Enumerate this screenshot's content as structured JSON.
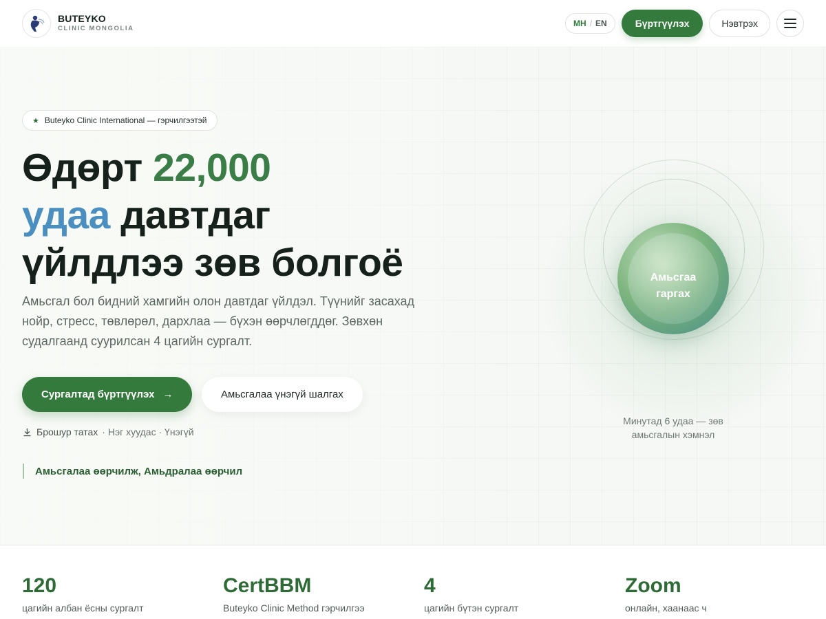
{
  "header": {
    "brand_name": "BUTEYKO",
    "brand_sub": "CLINIC MONGOLIA",
    "lang_active": "МН",
    "lang_separator": "/",
    "lang_other": "EN",
    "register_label": "Бүртгүүлэх",
    "login_label": "Нэвтрэх"
  },
  "hero": {
    "badge": "Buteyko Clinic International — гэрчилгээтэй",
    "headline_part1": "Өдөрт ",
    "headline_highlight1": "22,000",
    "headline_highlight2": "удаа",
    "headline_part2": " давтдаг",
    "headline_part3": "үйлдлээ зөв болгоё",
    "lead": "Амьсгал бол бидний хамгийн олон давтдаг үйлдэл. Түүнийг засахад нойр, стресс, төвлөрөл, дархлаа — бүхэн өөрчлөгддөг. Зөвхөн судалгаанд суурилсан 4 цагийн сургалт.",
    "cta_primary": "Сургалтад бүртгүүлэх",
    "cta_primary_arrow": "→",
    "cta_secondary": "Амьсгалаа үнэгүй шалгах",
    "download_label": "Брошур татах",
    "download_meta": "· Нэг хуудас · Үнэгүй",
    "slogan": "Амьсгалаа өөрчилж, Амьдралаа өөрчил"
  },
  "breath": {
    "label_line1": "Амьсгаа",
    "label_line2": "гаргах",
    "rhythm_text": "Минутад 6 удаа — зөв амьсгалын хэмнэл"
  },
  "stats": [
    {
      "value": "120",
      "label": "цагийн албан ёсны сургалт"
    },
    {
      "value": "CertBBM",
      "label": "Buteyko Clinic Method гэрчилгээ"
    },
    {
      "value": "4",
      "label": "цагийн бүтэн сургалт"
    },
    {
      "value": "Zoom",
      "label": "онлайн, хаанаас ч"
    }
  ],
  "colors": {
    "brand_green": "#347a3c",
    "accent_green": "#3b7d47",
    "accent_blue": "#4a8fbf"
  },
  "icons": {
    "badge": "star-icon",
    "download": "download-icon",
    "menu": "hamburger-menu-icon",
    "logo": "person-breathing-logo-icon"
  }
}
